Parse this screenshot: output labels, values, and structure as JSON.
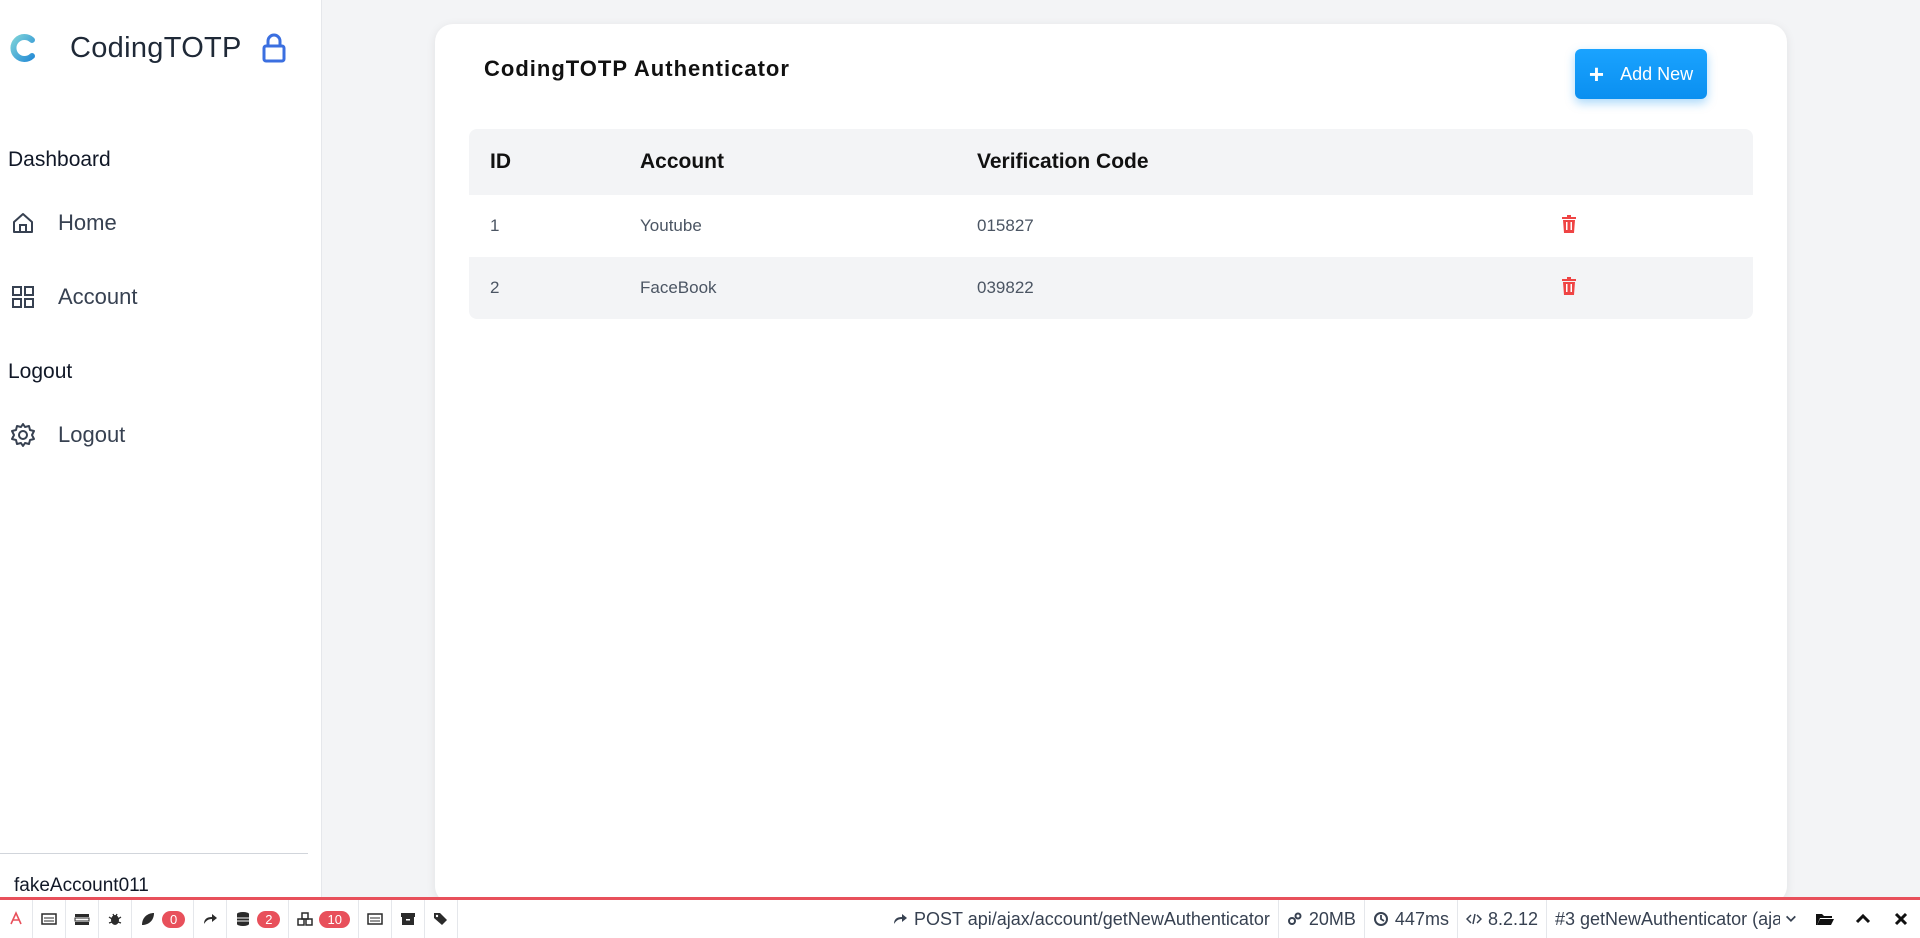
{
  "brand": {
    "name": "CodingTOTP",
    "logo_icon": "c-logo",
    "lock_icon": "lock-icon"
  },
  "sidebar": {
    "sections": [
      {
        "title": "Dashboard",
        "items": [
          {
            "label": "Home",
            "icon": "home-icon"
          },
          {
            "label": "Account",
            "icon": "grid-icon"
          }
        ]
      },
      {
        "title": "Logout",
        "items": [
          {
            "label": "Logout",
            "icon": "gear-icon"
          }
        ]
      }
    ],
    "user": "fakeAccount011"
  },
  "main": {
    "title": "CodingTOTP Authenticator",
    "add_button": {
      "icon": "plus",
      "label": "Add New"
    },
    "table": {
      "headers": {
        "id": "ID",
        "account": "Account",
        "code": "Verification Code"
      },
      "rows": [
        {
          "id": "1",
          "account": "Youtube",
          "code": "015827"
        },
        {
          "id": "2",
          "account": "FaceBook",
          "code": "039822"
        }
      ]
    }
  },
  "debugbar": {
    "badges": {
      "messages": "0",
      "queries": "2",
      "models": "10"
    },
    "request": "POST api/ajax/account/getNewAuthenticator",
    "memory": "20MB",
    "time": "447ms",
    "version": "8.2.12",
    "request_select": "#3 getNewAuthenticator (aja"
  },
  "colors": {
    "accent": "#0a8ff0",
    "danger": "#ef4444",
    "debug_red": "#e8505b",
    "lock_blue": "#3b6fe0"
  }
}
